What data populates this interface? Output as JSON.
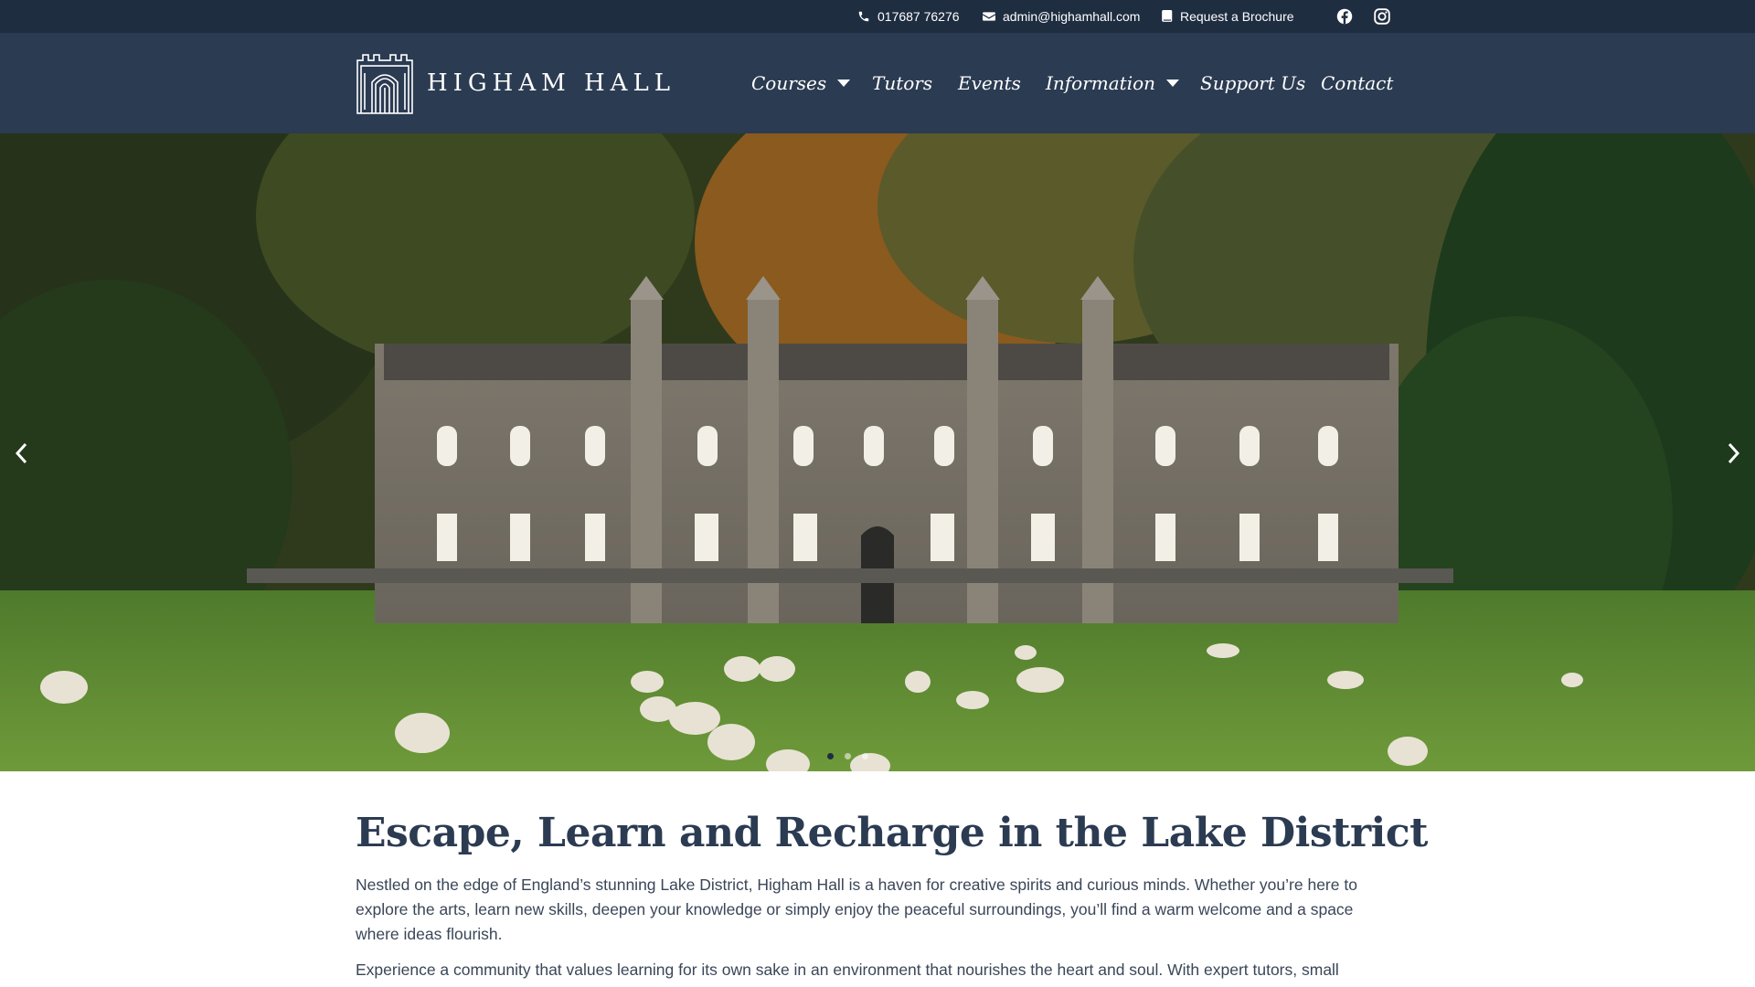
{
  "topbar": {
    "phone": "017687 76276",
    "email": "admin@highamhall.com",
    "brochure": "Request a Brochure",
    "social": [
      "facebook-icon",
      "instagram-icon"
    ]
  },
  "header": {
    "logo_text": "HIGHAM HALL",
    "nav": [
      {
        "label": "Courses",
        "dropdown": true
      },
      {
        "label": "Tutors",
        "dropdown": false
      },
      {
        "label": "Events",
        "dropdown": false
      },
      {
        "label": "Information",
        "dropdown": true
      },
      {
        "label": "Support Us",
        "dropdown": false
      },
      {
        "label": "Contact",
        "dropdown": false
      }
    ]
  },
  "hero": {
    "image": "Higham Hall building with sheep grazing on the lawn",
    "slides": 3,
    "active_slide": 1
  },
  "content": {
    "heading": "Escape, Learn and Recharge in the Lake District",
    "paragraph1": "Nestled on the edge of England’s stunning Lake District, Higham Hall is a haven for creative spirits and curious minds. Whether you’re here to explore the arts, learn new skills, deepen your knowledge or simply enjoy the peaceful surroundings, you’ll find a warm welcome and a space where ideas flourish.",
    "paragraph2": "Experience a community that values learning for its own sake in an environment that nourishes the heart and soul. With expert tutors, small"
  },
  "colors": {
    "topbar_bg": "#1f2d41",
    "header_bg": "#2b3b52",
    "heading": "#2b3b52"
  }
}
